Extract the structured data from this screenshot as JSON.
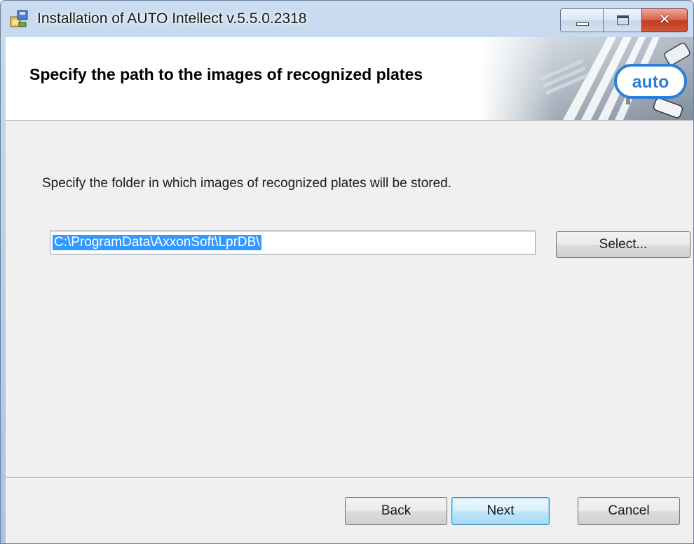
{
  "window": {
    "title": "Installation of AUTO Intellect v.5.5.0.2318",
    "controls": {
      "minimize": "minimize",
      "maximize": "maximize",
      "close": "✕"
    }
  },
  "banner": {
    "title": "Specify the path to the images of recognized plates",
    "logo_text": "auto"
  },
  "body": {
    "instruction": "Specify the folder in which images of recognized plates will be stored.",
    "path_value": "C:\\ProgramData\\AxxonSoft\\LprDB\\",
    "select_label": "Select..."
  },
  "footer": {
    "back_label": "Back",
    "next_label": "Next",
    "cancel_label": "Cancel"
  },
  "colors": {
    "selection": "#3399ff",
    "logo_accent": "#2f7fd6",
    "close_button": "#c13a20"
  },
  "icons": [
    "installer-icon",
    "minimize-icon",
    "maximize-icon",
    "close-icon",
    "auto-logo"
  ]
}
